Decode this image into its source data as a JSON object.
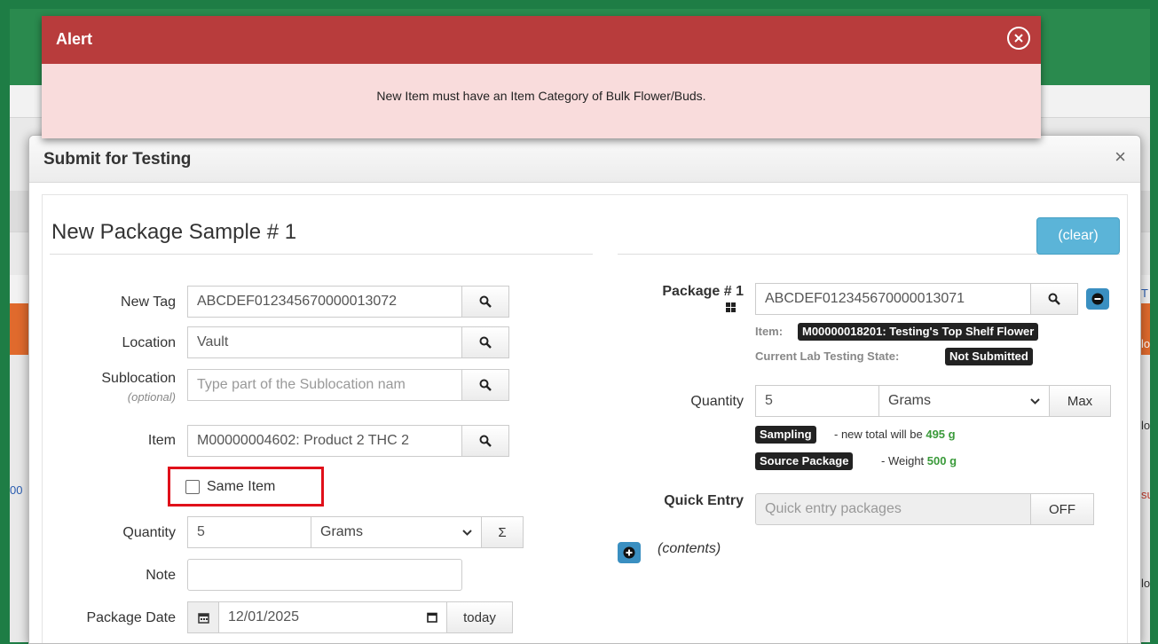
{
  "alert": {
    "title": "Alert",
    "close_symbol": "ⓧ",
    "message": "New Item must have an Item Category of Bulk Flower/Buds."
  },
  "background": {
    "link_left": "00",
    "edge_labels": [
      "T",
      "lo",
      "lo",
      "sul",
      "lo"
    ]
  },
  "modal": {
    "title": "Submit for Testing",
    "close_symbol": "×",
    "sample_title": "New Package Sample # 1",
    "clear_label": "(clear)"
  },
  "left_form": {
    "new_tag_label": "New Tag",
    "new_tag_value": "ABCDEF012345670000013072",
    "location_label": "Location",
    "location_value": "Vault",
    "sublocation_label": "Sublocation",
    "sublocation_optional": "(optional)",
    "sublocation_placeholder": "Type part of the Sublocation nam",
    "item_label": "Item",
    "item_value": "M00000004602: Product 2 THC 2",
    "same_item_label": "Same Item",
    "quantity_label": "Quantity",
    "quantity_value": "5",
    "unit_value": "Grams",
    "sum_symbol": "Σ",
    "note_label": "Note",
    "note_value": "",
    "package_date_label": "Package Date",
    "package_date_value": "12/01/2025",
    "today_label": "today"
  },
  "right_form": {
    "package_label": "Package # 1",
    "package_value": "ABCDEF012345670000013071",
    "item_prefix": "Item:",
    "item_badge": "M00000018201: Testing's Top Shelf Flower",
    "lab_state_prefix": "Current Lab Testing State:",
    "lab_state_badge": "Not Submitted",
    "quantity_label": "Quantity",
    "quantity_value": "5",
    "unit_value": "Grams",
    "max_label": "Max",
    "sampling_badge": "Sampling",
    "sampling_text": "- new total will be",
    "sampling_total": "495 g",
    "source_badge": "Source Package",
    "source_text": "- Weight",
    "source_weight": "500 g",
    "quick_entry_label": "Quick Entry",
    "quick_entry_placeholder": "Quick entry packages",
    "quick_entry_toggle": "OFF",
    "contents_label": "(contents)"
  },
  "colors": {
    "alert_header": "#b83c3c",
    "alert_body": "#f9dcdc",
    "accent_blue": "#5bb4d8",
    "highlight_red": "#e0101a",
    "page_green": "#1e7d45"
  }
}
